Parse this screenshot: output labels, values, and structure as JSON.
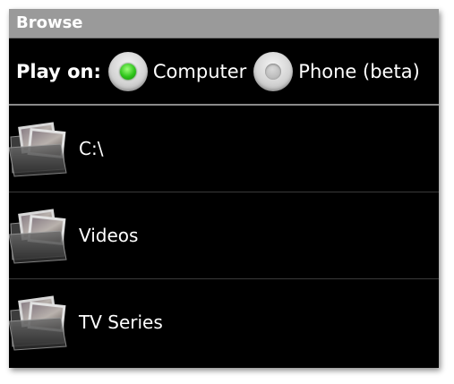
{
  "window": {
    "title": "Browse"
  },
  "play_on": {
    "label": "Play on:",
    "options": [
      {
        "label": "Computer",
        "selected": true
      },
      {
        "label": "Phone (beta)",
        "selected": false
      }
    ]
  },
  "folders": [
    {
      "label": "C:\\",
      "icon": "photo-folder-icon"
    },
    {
      "label": "Videos",
      "icon": "photo-folder-icon"
    },
    {
      "label": "TV Series",
      "icon": "photo-folder-icon"
    }
  ],
  "colors": {
    "titlebar_bg": "#9a9a9a",
    "background": "#000000",
    "selected_radio": "#2ec41a"
  }
}
